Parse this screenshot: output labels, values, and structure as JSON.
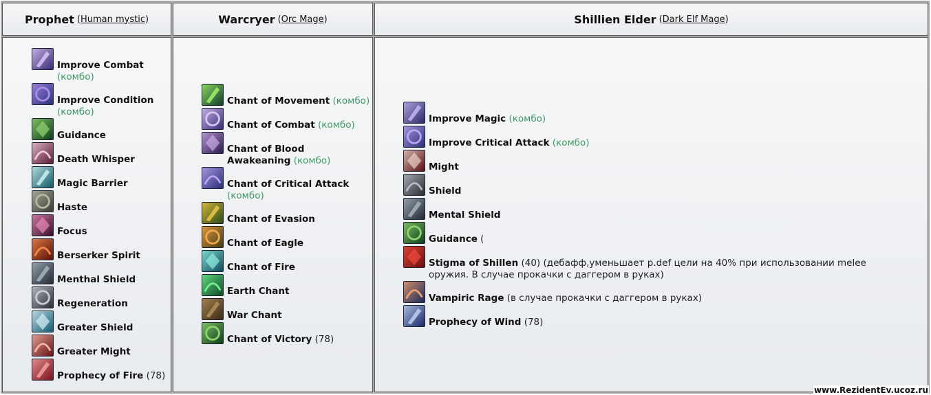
{
  "columns": [
    {
      "id": "prophet",
      "title": "Prophet",
      "subtitle_link": "Human mystic",
      "skills": [
        {
          "name": "Improve Combat",
          "combo": "(комбо)",
          "icon": "improve-combat-icon",
          "c1": "#3a2a78",
          "c2": "#d7c6f2"
        },
        {
          "name": "Improve Condition",
          "combo": "(комбо)",
          "icon": "improve-condition-icon",
          "c1": "#2c2f7a",
          "c2": "#a98ee8"
        },
        {
          "name": "Guidance",
          "icon": "guidance-icon",
          "c1": "#0f3d1a",
          "c2": "#8fd36f"
        },
        {
          "name": "Death Whisper",
          "icon": "death-whisper-icon",
          "c1": "#5a1b36",
          "c2": "#f0c9d8"
        },
        {
          "name": "Magic Barrier",
          "icon": "magic-barrier-icon",
          "c1": "#0f5a66",
          "c2": "#cdeff2"
        },
        {
          "name": "Haste",
          "icon": "haste-icon",
          "c1": "#3d3b33",
          "c2": "#b3b9a4"
        },
        {
          "name": "Focus",
          "icon": "focus-icon",
          "c1": "#3a0e2a",
          "c2": "#e58ab5"
        },
        {
          "name": "Berserker Spirit",
          "icon": "berserker-spirit-icon",
          "c1": "#5a0f0a",
          "c2": "#f08a4a"
        },
        {
          "name": "Menthal Shield",
          "icon": "menthal-shield-icon",
          "c1": "#222833",
          "c2": "#a6b3bf"
        },
        {
          "name": "Regeneration",
          "icon": "regeneration-icon",
          "c1": "#2b2d33",
          "c2": "#c9ccd6"
        },
        {
          "name": "Greater Shield",
          "icon": "greater-shield-icon",
          "c1": "#105a73",
          "c2": "#d6eef5"
        },
        {
          "name": "Greater Might",
          "icon": "greater-might-icon",
          "c1": "#6a1010",
          "c2": "#f0b7a8"
        },
        {
          "name": "Prophecy of Fire",
          "extra": "(78)",
          "icon": "prophecy-of-fire-icon",
          "c1": "#7a0f1a",
          "c2": "#f2a0a0"
        }
      ]
    },
    {
      "id": "warcryer",
      "title": "Warcryer",
      "subtitle_link": "Orc Mage",
      "skills": [
        {
          "name": "Chant of Movement",
          "combo": "(комбо)",
          "icon": "chant-of-movement-icon",
          "c1": "#0f3d2a",
          "c2": "#a0f06a"
        },
        {
          "name": "Chant of Combat",
          "combo": "(комбо)",
          "icon": "chant-of-combat-icon",
          "c1": "#3a2a78",
          "c2": "#d7c6f2"
        },
        {
          "name": "Chant of Blood Awakeaning",
          "combo": "(комбо)",
          "icon": "chant-of-blood-awakening-icon",
          "c1": "#2a1d4a",
          "c2": "#c9a9e8"
        },
        {
          "name": "Chant of Critical Attack",
          "combo": "(комбо)",
          "icon": "chant-of-critical-attack-icon",
          "c1": "#2c2f7a",
          "c2": "#b9a6ee"
        },
        {
          "name": "Chant of Evasion",
          "icon": "chant-of-evasion-icon",
          "c1": "#2a4a12",
          "c2": "#f0c64a"
        },
        {
          "name": "Chant of Eagle",
          "icon": "chant-of-eagle-icon",
          "c1": "#4a3a12",
          "c2": "#f0a84a"
        },
        {
          "name": "Chant of Fire",
          "icon": "chant-of-fire-icon",
          "c1": "#0f4a5a",
          "c2": "#8ff0e0"
        },
        {
          "name": "Earth Chant",
          "icon": "earth-chant-icon",
          "c1": "#0f4a2a",
          "c2": "#6ff08a"
        },
        {
          "name": "War Chant",
          "icon": "war-chant-icon",
          "c1": "#3a2a18",
          "c2": "#b58e5a"
        },
        {
          "name": "Chant of Victory",
          "extra": "(78)",
          "icon": "chant-of-victory-icon",
          "c1": "#0f3d1a",
          "c2": "#8fd36f"
        }
      ]
    },
    {
      "id": "shillien-elder",
      "title": "Shillien Elder",
      "subtitle_link": "Dark Elf Mage",
      "skills": [
        {
          "name": "Improve Magic",
          "combo": "(комбо)",
          "icon": "improve-magic-icon",
          "c1": "#2a2a6a",
          "c2": "#c6b6f0"
        },
        {
          "name": "Improve Critical Attack",
          "combo": "(комбо)",
          "icon": "improve-critical-attack-icon",
          "c1": "#2c2f7a",
          "c2": "#b9a6ee"
        },
        {
          "name": "Might",
          "icon": "might-icon",
          "c1": "#5a1010",
          "c2": "#e8d0c8"
        },
        {
          "name": "Shield",
          "icon": "shield-icon",
          "c1": "#2b2d33",
          "c2": "#b6bcc4"
        },
        {
          "name": "Mental Shield",
          "icon": "mental-shield-icon",
          "c1": "#222833",
          "c2": "#a6b3bf"
        },
        {
          "name": "Guidance",
          "extra": "(",
          "icon": "guidance-icon",
          "c1": "#0f3d1a",
          "c2": "#8fd36f"
        },
        {
          "name": "Stigma of Shillen",
          "extra": "(40) (дебафф,уменьшает p.def цели на 40% при использовании melee оружия. В случае прокачки с даггером в руках)",
          "icon": "stigma-of-shillen-icon",
          "c1": "#6a0f0f",
          "c2": "#f04a3a"
        },
        {
          "name": "Vampiric Rage",
          "extra": "(в случае прокачки с даггером в руках)",
          "icon": "vampiric-rage-icon",
          "c1": "#1a2a5a",
          "c2": "#f0a070"
        },
        {
          "name": "Prophecy of Wind",
          "extra": "(78)",
          "icon": "prophecy-of-wind-icon",
          "c1": "#1a2a6a",
          "c2": "#c0d0f0"
        }
      ]
    }
  ],
  "watermark": "www.RezidentEv.ucoz.ru"
}
